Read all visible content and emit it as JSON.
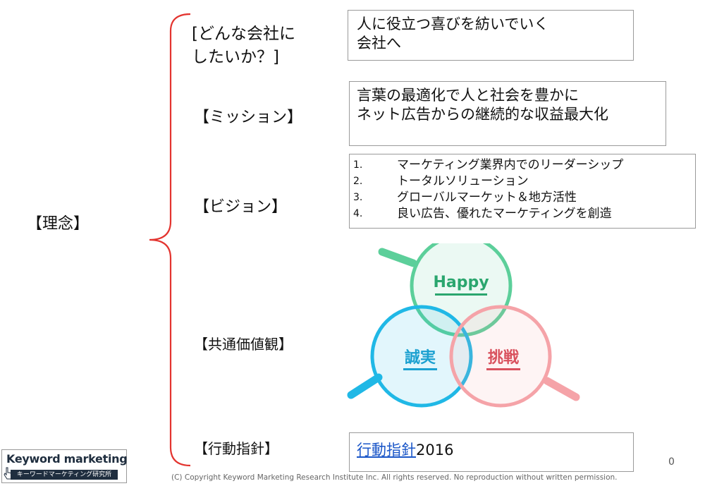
{
  "labels": {
    "rinen": "【理念】",
    "company_q_line1": "[どんな会社に",
    "company_q_line2": "したいか？]",
    "mission": "【ミッション】",
    "vision": "【ビジョン】",
    "values": "【共通価値観】",
    "action": "【行動指針】"
  },
  "company_box": "人に役立つ喜びを紡いでいく\n会社へ",
  "mission_box": "言葉の最適化で人と社会を豊かに\nネット広告からの継続的な収益最大化",
  "vision_items": [
    {
      "num": "1.",
      "text": "マーケティング業界内でのリーダーシップ"
    },
    {
      "num": "2.",
      "text": "トータルソリューション"
    },
    {
      "num": "3.",
      "text": "グローバルマーケット＆地方活性"
    },
    {
      "num": "4.",
      "text": "良い広告、優れたマーケティングを創造"
    }
  ],
  "values_diagram": {
    "happy": "Happy",
    "seijitsu": "誠実",
    "chousen": "挑戦",
    "colors": {
      "green": "#5ccf9a",
      "blue": "#20b8e6",
      "pink": "#f5a3a8",
      "green_text": "#2aa66e",
      "blue_text": "#1aa0d0",
      "pink_text": "#d9525e"
    }
  },
  "action_box": {
    "link": "行動指針",
    "suffix": "2016"
  },
  "footer": "(C) Copyright   Keyword Marketing Research Institute Inc. All rights reserved. No reproduction without written permission.",
  "page_number": "0",
  "logo": {
    "line1": "Keyword marketing",
    "line2": "キーワードマーケティング研究所"
  },
  "brace_color": "#e3342f"
}
